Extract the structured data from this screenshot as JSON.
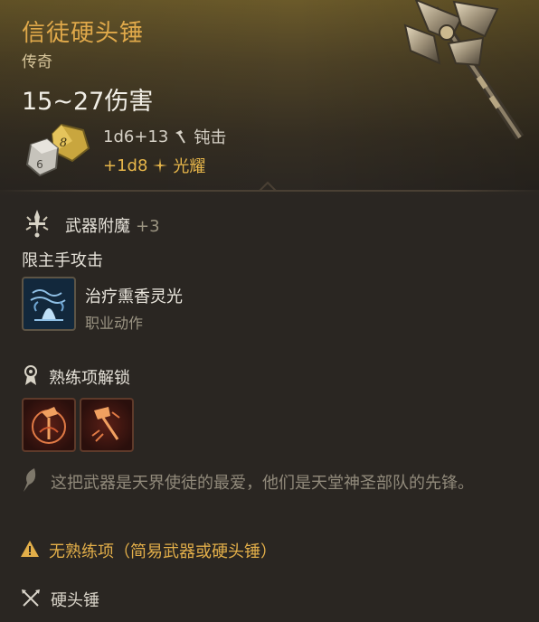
{
  "item": {
    "name": "信徒硬头锤",
    "rarity": "传奇",
    "damage_summary": "15~27伤害"
  },
  "damage_lines": [
    {
      "dice": "1d6+13",
      "type": "钝击",
      "icon": "hammer-icon"
    },
    {
      "dice": "+1d8",
      "type": "光耀",
      "icon": "radiant-icon"
    }
  ],
  "dice_face_number": "8",
  "enchantment": {
    "label": "武器附魔",
    "bonus": "+3",
    "icon": "sword-enchant-icon"
  },
  "restriction": "限主手攻击",
  "action": {
    "name": "治疗熏香灵光",
    "type": "职业动作",
    "icon": "healing-incense-icon"
  },
  "proficiency": {
    "title": "熟练项解锁",
    "icon": "proficiency-icon",
    "unlock_icons": [
      "unlock-icon-1",
      "unlock-icon-2"
    ]
  },
  "description": "这把武器是天界使徒的最爱，他们是天堂神圣部队的先锋。",
  "warning": "无熟练项（简易武器或硬头锤）",
  "weapon_type": "硬头锤",
  "colors": {
    "title": "#e0a94a",
    "radiant": "#e7b64a",
    "warning": "#e2ae49",
    "text": "#e6e2d9",
    "muted": "#9b9483",
    "background": "#2a2622"
  }
}
